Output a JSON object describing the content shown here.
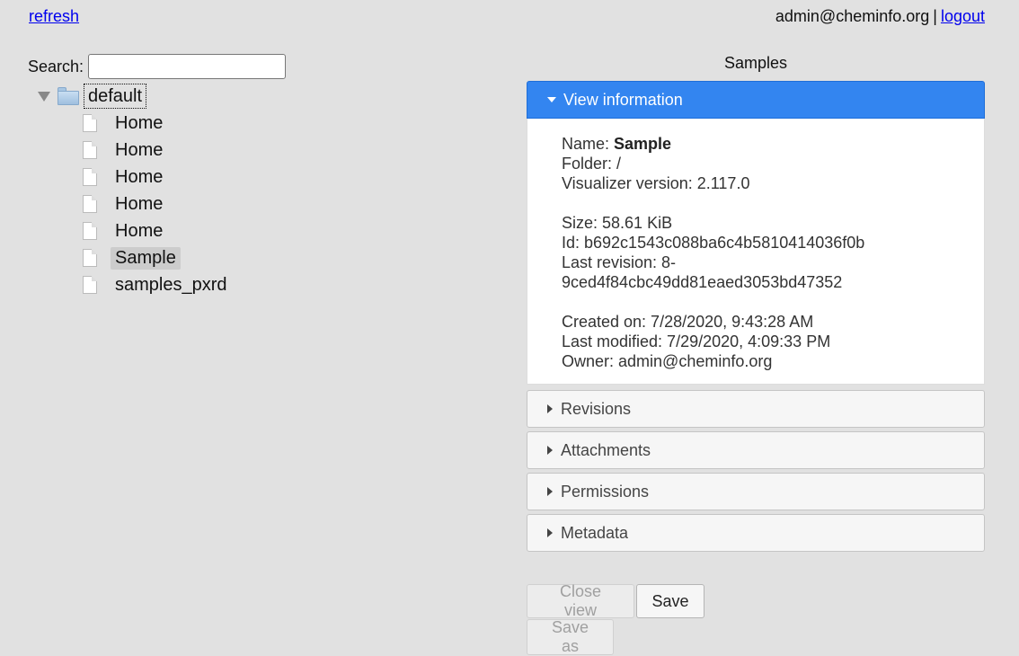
{
  "header": {
    "refresh_label": "refresh",
    "user_email": "admin@cheminfo.org",
    "separator": "|",
    "logout_label": "logout"
  },
  "search": {
    "label": "Search:",
    "value": ""
  },
  "tree": {
    "folder_label": "default",
    "files": [
      {
        "label": "Home",
        "selected": false
      },
      {
        "label": "Home",
        "selected": false
      },
      {
        "label": "Home",
        "selected": false
      },
      {
        "label": "Home",
        "selected": false
      },
      {
        "label": "Home",
        "selected": false
      },
      {
        "label": "Sample",
        "selected": true
      },
      {
        "label": "samples_pxrd",
        "selected": false
      }
    ]
  },
  "panel": {
    "title": "Samples",
    "sections": {
      "view_information": "View information",
      "revisions": "Revisions",
      "attachments": "Attachments",
      "permissions": "Permissions",
      "metadata": "Metadata"
    },
    "info": {
      "name_label": "Name:",
      "name_value": "Sample",
      "folder": "Folder: /",
      "visualizer_version": "Visualizer version: 2.117.0",
      "size": "Size: 58.61 KiB",
      "id": "Id: b692c1543c088ba6c4b5810414036f0b",
      "last_revision_line1": "Last revision: 8-",
      "last_revision_line2": "9ced4f84cbc49dd81eaed3053bd47352",
      "created_on": "Created on: 7/28/2020, 9:43:28 AM",
      "last_modified": "Last modified: 7/29/2020, 4:09:33 PM",
      "owner": "Owner: admin@cheminfo.org"
    }
  },
  "buttons": {
    "close_view": "Close view",
    "save": "Save",
    "save_as": "Save as"
  },
  "colors": {
    "active_header": "#3385f0",
    "background": "#e1e1e1"
  }
}
